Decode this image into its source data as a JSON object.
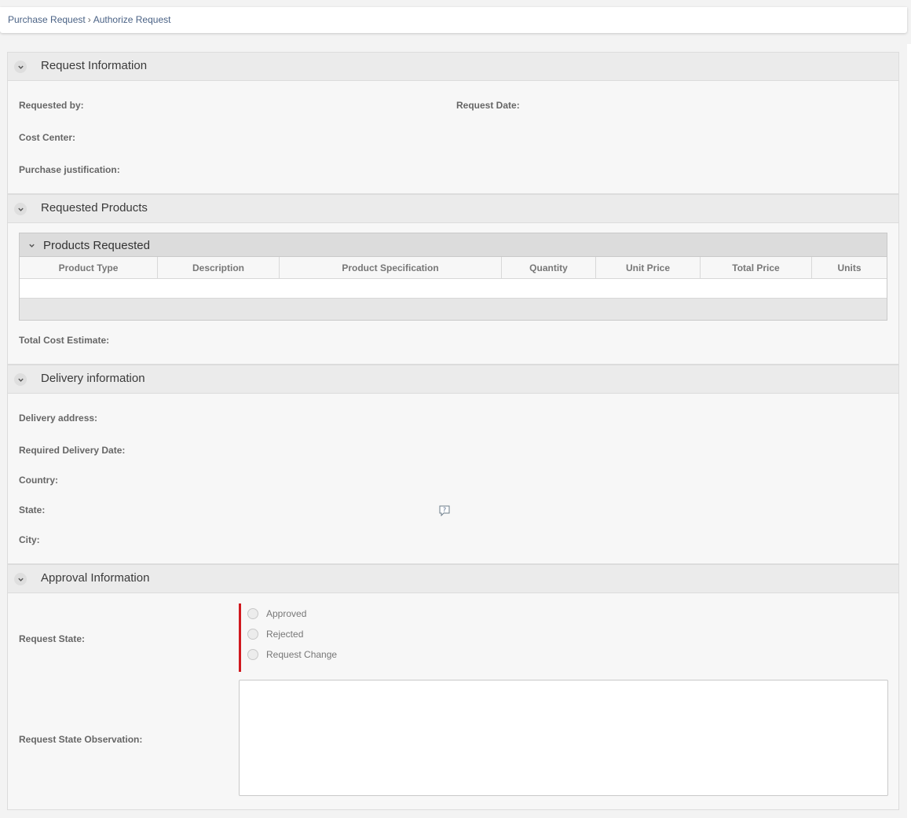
{
  "breadcrumb": {
    "parent": "Purchase Request",
    "separator": "›",
    "current": "Authorize Request"
  },
  "icons": {
    "toggle": "chevron-down-icon",
    "help": "question-bubble-icon"
  },
  "colors": {
    "required_marker": "#d0191f",
    "breadcrumb_link": "#4a6285"
  },
  "sections": {
    "request_info": {
      "title": "Request Information",
      "requested_by": "Requested by:",
      "request_date": "Request Date:",
      "cost_center": "Cost Center:",
      "justification": "Purchase justification:"
    },
    "requested_products": {
      "title": "Requested Products",
      "grid_title": "Products Requested",
      "columns": [
        "Product Type",
        "Description",
        "Product Specification",
        "Quantity",
        "Unit Price",
        "Total Price",
        "Units"
      ],
      "total_cost": "Total Cost Estimate:"
    },
    "delivery": {
      "title": "Delivery information",
      "address": "Delivery address:",
      "required_date": "Required Delivery Date:",
      "country": "Country:",
      "state": "State:",
      "city": "City:"
    },
    "approval": {
      "title": "Approval Information",
      "request_state": "Request State:",
      "options": [
        "Approved",
        "Rejected",
        "Request Change"
      ],
      "observation": "Request State Observation:",
      "observation_value": ""
    }
  }
}
